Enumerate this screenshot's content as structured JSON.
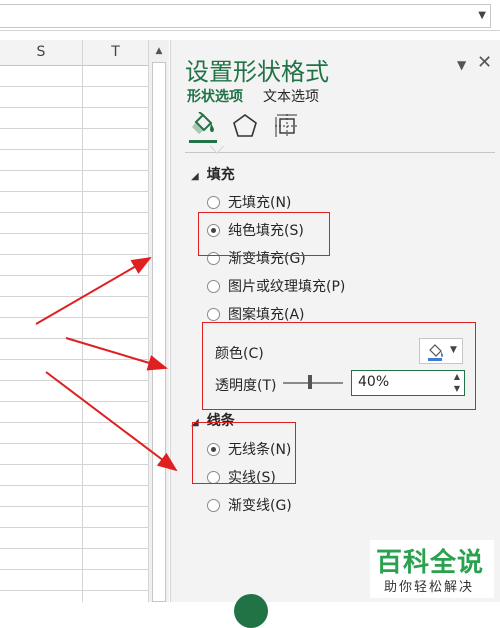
{
  "sheet": {
    "columns": [
      "S",
      "T"
    ]
  },
  "pane": {
    "title": "设置形状格式",
    "tabs": [
      {
        "label": "形状选项",
        "active": true
      },
      {
        "label": "文本选项",
        "active": false
      }
    ],
    "fill_section": {
      "heading": "填充",
      "options": [
        {
          "label": "无填充(N)",
          "checked": false
        },
        {
          "label": "纯色填充(S)",
          "checked": true
        },
        {
          "label": "渐变填充(G)",
          "checked": false
        },
        {
          "label": "图片或纹理填充(P)",
          "checked": false
        },
        {
          "label": "图案填充(A)",
          "checked": false
        }
      ],
      "color_label": "颜色(C)",
      "transparency_label": "透明度(T)",
      "transparency_value": "40%",
      "transparency_fraction": 0.4
    },
    "line_section": {
      "heading": "线条",
      "options": [
        {
          "label": "无线条(N)",
          "checked": true
        },
        {
          "label": "实线(S)",
          "checked": false
        },
        {
          "label": "渐变线(G)",
          "checked": false
        }
      ]
    }
  },
  "icons": {
    "fill": "paint-bucket-icon",
    "effects": "pentagon-icon",
    "size": "size-properties-icon"
  },
  "watermark": {
    "main": "百科全说",
    "sub": "助你轻松解决"
  },
  "colors": {
    "accent": "#217346",
    "annotation": "#e02020",
    "watermark": "#2aa14f"
  }
}
